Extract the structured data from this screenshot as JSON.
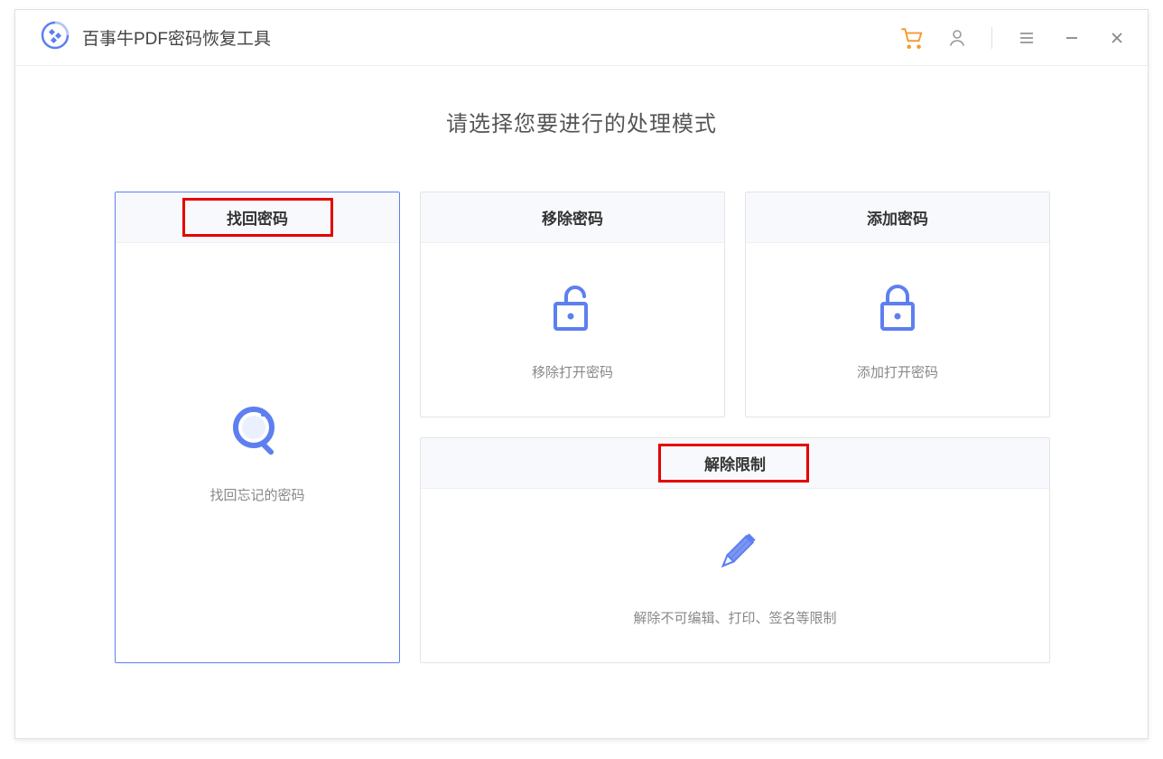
{
  "app": {
    "title": "百事牛PDF密码恢复工具"
  },
  "main": {
    "heading": "请选择您要进行的处理模式",
    "cards": {
      "recover": {
        "title": "找回密码",
        "desc": "找回忘记的密码"
      },
      "remove": {
        "title": "移除密码",
        "desc": "移除打开密码"
      },
      "add": {
        "title": "添加密码",
        "desc": "添加打开密码"
      },
      "unlock": {
        "title": "解除限制",
        "desc": "解除不可编辑、打印、签名等限制"
      }
    }
  },
  "colors": {
    "accent": "#5d7ff0",
    "cart": "#f59a2f"
  }
}
